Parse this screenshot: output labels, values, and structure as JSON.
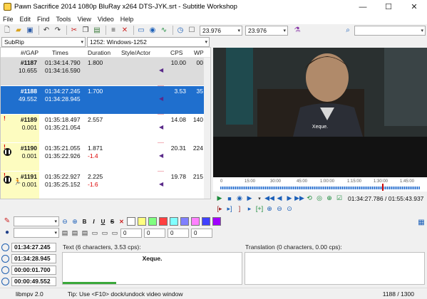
{
  "window": {
    "title": "Pawn Sacrifice 2014 1080p BluRay x264 DTS-JYK.srt - Subtitle Workshop",
    "minimize": "—",
    "maximize": "☐",
    "close": "✕"
  },
  "menu": [
    "File",
    "Edit",
    "Find",
    "Tools",
    "View",
    "Video",
    "Help"
  ],
  "toolbar": {
    "fps_input": "23.976",
    "fps_output": "23.976",
    "search_value": ""
  },
  "format": {
    "format": "SubRip",
    "encoding": "1252: Windows-1252"
  },
  "grid": {
    "headers": [
      "#/GAP",
      "Times",
      "Duration",
      "Style/Actor",
      "CPS",
      "WP"
    ],
    "rows": [
      {
        "num": "#1187",
        "gap": "10.655",
        "start": "01:34:14.790",
        "end": "01:34:16.590",
        "duration": "1.800",
        "delta": "",
        "cps": "10.00",
        "wp": "00",
        "selected": false,
        "warn": false
      },
      {
        "num": "#1188",
        "gap": "49.552",
        "start": "01:34:27.245",
        "end": "01:34:28.945",
        "duration": "1.700",
        "delta": "",
        "cps": "3.53",
        "wp": "35",
        "selected": true,
        "warn": false
      },
      {
        "num": "#1189",
        "gap": "0.001",
        "start": "01:35:18.497",
        "end": "01:35:21.054",
        "duration": "2.557",
        "delta": "",
        "cps": "14.08",
        "wp": "140",
        "selected": false,
        "warn": true
      },
      {
        "num": "#1190",
        "gap": "0.001",
        "start": "01:35:21.055",
        "end": "01:35:22.926",
        "duration": "1.871",
        "delta": "-1.4",
        "cps": "20.31",
        "wp": "224",
        "selected": false,
        "warn": true
      },
      {
        "num": "#1191",
        "gap": "0.001",
        "start": "01:35:22.927",
        "end": "01:35:25.152",
        "duration": "2.225",
        "delta": "-1.6",
        "cps": "19.78",
        "wp": "215",
        "selected": false,
        "warn": true
      }
    ]
  },
  "video": {
    "subtitle": "Xeque.",
    "timeline_ticks": [
      "0",
      "15:00",
      "30:00",
      "45:00",
      "1:00:00",
      "1:15:00",
      "1:30:00",
      "1:45:00"
    ],
    "position": "01:34:27.786",
    "duration": "01:55:43.937",
    "position_sep": "/",
    "progress": 0.81
  },
  "editor": {
    "start": "01:34:27.245",
    "end": "01:34:28.945",
    "duration": "00:00:01.700",
    "gap": "00:00:49.552",
    "text_label": "Text (6 characters, 3.53 cps):",
    "text_value": "Xeque.",
    "translation_label": "Translation (0 characters, 0.00 cps):",
    "margins": [
      "0",
      "0",
      "0",
      "0"
    ],
    "swatches": [
      "#ffffff",
      "#ffff80",
      "#80ff80",
      "#ff4040",
      "#80ffff",
      "#8080ff",
      "#ff80ff",
      "#4040ff",
      "#a000ff"
    ]
  },
  "status": {
    "player": "libmpv 2.0",
    "tip": "Tip: Use <F10> dock/undock video window",
    "count": "1188 / 1300"
  }
}
